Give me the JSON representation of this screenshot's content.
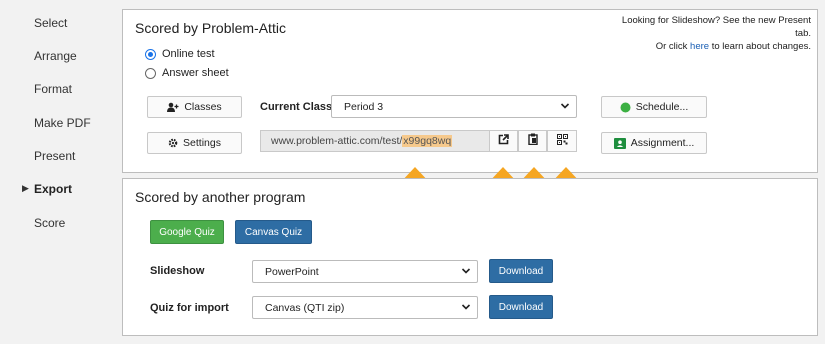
{
  "sidebar": {
    "items": [
      {
        "label": "Select"
      },
      {
        "label": "Arrange"
      },
      {
        "label": "Format"
      },
      {
        "label": "Make PDF"
      },
      {
        "label": "Present"
      },
      {
        "label": "Export"
      },
      {
        "label": "Score"
      }
    ],
    "active": "Export"
  },
  "problem_attic": {
    "title": "Scored by Problem-Attic",
    "notice_line1": "Looking for Slideshow? See the new Present tab.",
    "notice_pre": "Or click ",
    "notice_link": "here",
    "notice_post": " to learn about changes.",
    "radio_online": "Online test",
    "radio_answer": "Answer sheet",
    "selected_mode": "Online test",
    "classes_label": "Classes",
    "current_class_label": "Current Class:",
    "current_class_value": "Period 3",
    "schedule_label": "Schedule...",
    "settings_label": "Settings",
    "url_prefix": "www.problem-attic.com/test/",
    "url_code": "x99gq8wq",
    "assignment_label": "Assignment..."
  },
  "other_program": {
    "title": "Scored by another program",
    "google_quiz": "Google Quiz",
    "canvas_quiz": "Canvas Quiz",
    "slideshow_label": "Slideshow",
    "slideshow_value": "PowerPoint",
    "download1": "Download",
    "quiz_import_label": "Quiz for import",
    "quiz_import_value": "Canvas (QTI zip)",
    "download2": "Download"
  },
  "colors": {
    "accent_blue": "#2e6da4",
    "accent_green": "#4cae4c",
    "highlight_arrow": "#f5a623",
    "schedule_dot": "#3cb043",
    "assignment_icon": "#1e8e3e"
  },
  "icons": {
    "classes": "add-user-icon",
    "settings": "gear-icon",
    "open": "open-external-icon",
    "clipboard": "clipboard-icon",
    "qr": "qr-code-icon",
    "schedule": "green-dot-icon",
    "assignment": "google-classroom-icon"
  }
}
